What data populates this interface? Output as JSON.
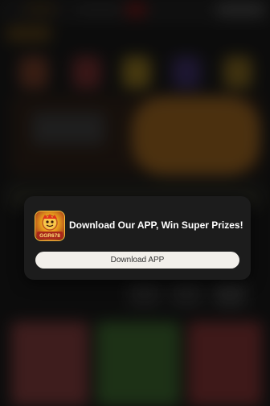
{
  "modal": {
    "title": "Download Our APP, Win Super Prizes!",
    "button_label": "Download APP",
    "icon_name": "app-logo-icon",
    "icon_text": "GGR678"
  },
  "colors": {
    "card_background": "#1c1c1c",
    "button_background": "#f2efea",
    "button_text": "#333333",
    "title_text": "#ffffff"
  }
}
